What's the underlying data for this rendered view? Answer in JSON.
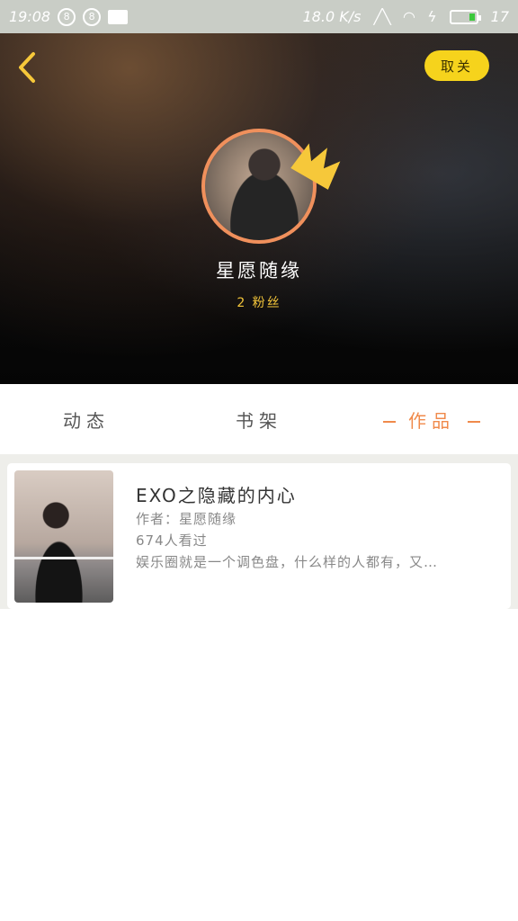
{
  "status_bar": {
    "time": "19:08",
    "speed": "18.0 K/s",
    "battery_level": "17"
  },
  "header": {
    "follow_label": "取关",
    "username": "星愿随缘",
    "fans_text": "2 粉丝"
  },
  "tabs": [
    {
      "label": "动态"
    },
    {
      "label": "书架"
    },
    {
      "label": "作品"
    }
  ],
  "books": [
    {
      "title": "EXO之隐藏的内心",
      "author": "作者：星愿随缘",
      "views": "674人看过",
      "description": "娱乐圈就是一个调色盘，什么样的人都有，又…"
    }
  ],
  "colors": {
    "accent": "#f08a4b",
    "follow_button": "#f6d31c",
    "crown": "#f6c83a",
    "fans_text": "#f3c53a",
    "avatar_ring": "#f0905c"
  },
  "icons": {
    "back": "chevron-left-icon",
    "crown": "crown-icon"
  }
}
